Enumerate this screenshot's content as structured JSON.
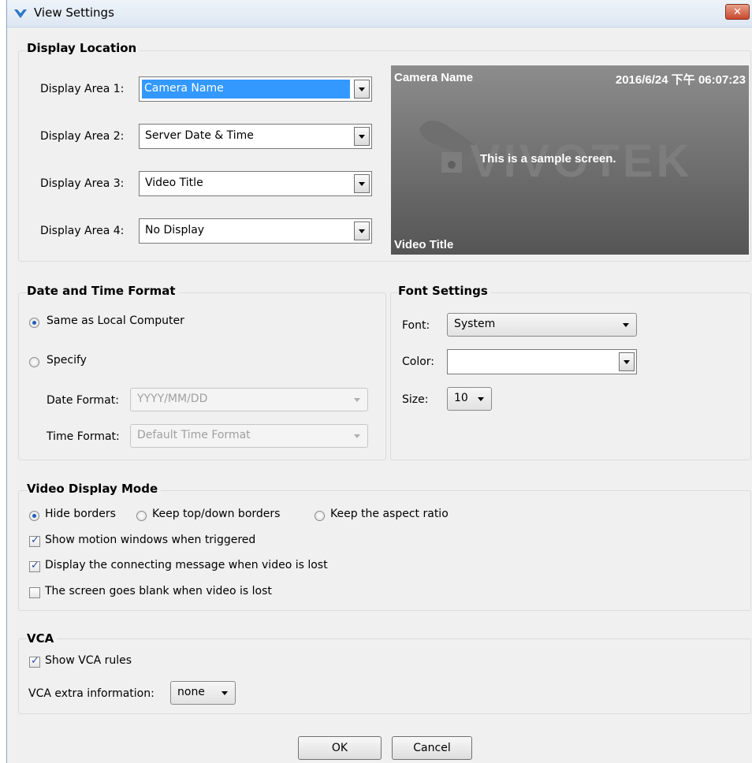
{
  "window": {
    "title": "View Settings",
    "close_label": "✕"
  },
  "display_location": {
    "title": "Display Location",
    "areas": [
      {
        "label": "Display Area 1:",
        "value": "Camera Name"
      },
      {
        "label": "Display Area 2:",
        "value": "Server Date & Time"
      },
      {
        "label": "Display Area 3:",
        "value": "Video Title"
      },
      {
        "label": "Display Area 4:",
        "value": "No Display"
      }
    ],
    "preview": {
      "camera_name": "Camera Name",
      "datetime": "2016/6/24 下午 06:07:23",
      "sample_text": "This is a sample screen.",
      "video_title": "Video Title",
      "logo": "VIVOTEK"
    }
  },
  "date_time_format": {
    "title": "Date and Time Format",
    "option_local": "Same as Local Computer",
    "option_specify": "Specify",
    "date_format_label": "Date Format:",
    "date_format_value": "YYYY/MM/DD",
    "time_format_label": "Time Format:",
    "time_format_value": "Default Time Format"
  },
  "font_settings": {
    "title": "Font Settings",
    "font_label": "Font:",
    "font_value": "System",
    "color_label": "Color:",
    "color_value": "",
    "size_label": "Size:",
    "size_value": "10"
  },
  "video_display_mode": {
    "title": "Video Display Mode",
    "mode_hide": "Hide borders",
    "mode_keep_top": "Keep top/down borders",
    "mode_keep_aspect": "Keep the aspect ratio",
    "show_motion": "Show motion windows when triggered",
    "display_connecting": "Display the connecting message when video is lost",
    "screen_blank": "The screen goes blank when video is lost"
  },
  "vca": {
    "title": "VCA",
    "show_rules": "Show VCA rules",
    "extra_label": "VCA extra information:",
    "extra_value": "none"
  },
  "buttons": {
    "ok": "OK",
    "cancel": "Cancel"
  },
  "colors": {
    "selection": "#3399ff",
    "radio_dot": "#1f5fb8",
    "close_button": "#c9482d"
  }
}
